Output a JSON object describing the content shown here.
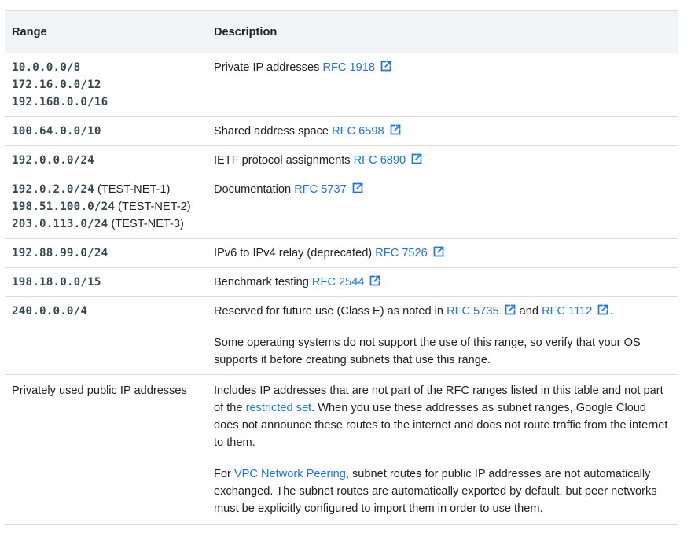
{
  "table": {
    "headers": {
      "range": "Range",
      "description": "Description"
    },
    "rows": [
      {
        "ranges": [
          {
            "code": "10.0.0.0/8",
            "note": ""
          },
          {
            "code": "172.16.0.0/12",
            "note": ""
          },
          {
            "code": "192.168.0.0/16",
            "note": ""
          }
        ],
        "desc_text": "Private IP addresses ",
        "rfc": "RFC 1918"
      },
      {
        "ranges": [
          {
            "code": "100.64.0.0/10",
            "note": ""
          }
        ],
        "desc_text": "Shared address space ",
        "rfc": "RFC 6598"
      },
      {
        "ranges": [
          {
            "code": "192.0.0.0/24",
            "note": ""
          }
        ],
        "desc_text": "IETF protocol assignments ",
        "rfc": "RFC 6890"
      },
      {
        "ranges": [
          {
            "code": "192.0.2.0/24",
            "note": " (TEST-NET-1)"
          },
          {
            "code": "198.51.100.0/24",
            "note": " (TEST-NET-2)"
          },
          {
            "code": "203.0.113.0/24",
            "note": " (TEST-NET-3)"
          }
        ],
        "desc_text": "Documentation ",
        "rfc": "RFC 5737"
      },
      {
        "ranges": [
          {
            "code": "192.88.99.0/24",
            "note": ""
          }
        ],
        "desc_text": "IPv6 to IPv4 relay (deprecated) ",
        "rfc": "RFC 7526"
      },
      {
        "ranges": [
          {
            "code": "198.18.0.0/15",
            "note": ""
          }
        ],
        "desc_text": "Benchmark testing ",
        "rfc": "RFC 2544"
      }
    ],
    "class_e": {
      "range": "240.0.0.0/4",
      "text_before": "Reserved for future use (Class E) as noted in ",
      "rfc_a": "RFC 5735",
      "text_between": " and ",
      "rfc_b": "RFC 1112",
      "text_after": ".",
      "para2": "Some operating systems do not support the use of this range, so verify that your OS supports it before creating subnets that use this range."
    },
    "privately_used": {
      "range_label": "Privately used public IP addresses",
      "p1_before": "Includes IP addresses that are not part of the RFC ranges listed in this table and not part of the ",
      "p1_link": "restricted set",
      "p1_after": ". When you use these addresses as subnet ranges, Google Cloud does not announce these routes to the internet and does not route traffic from the internet to them.",
      "p2_before": "For ",
      "p2_link": "VPC Network Peering",
      "p2_after": ", subnet routes for public IP addresses are not automatically exchanged. The subnet routes are automatically exported by default, but peer networks must be explicitly configured to import them in order to use them."
    }
  },
  "icons": {
    "external_link": "external-link-icon"
  },
  "colors": {
    "link": "#1a73e8",
    "header_bg": "#f1f3f4",
    "border": "#dadce0",
    "code": "#37474f"
  }
}
